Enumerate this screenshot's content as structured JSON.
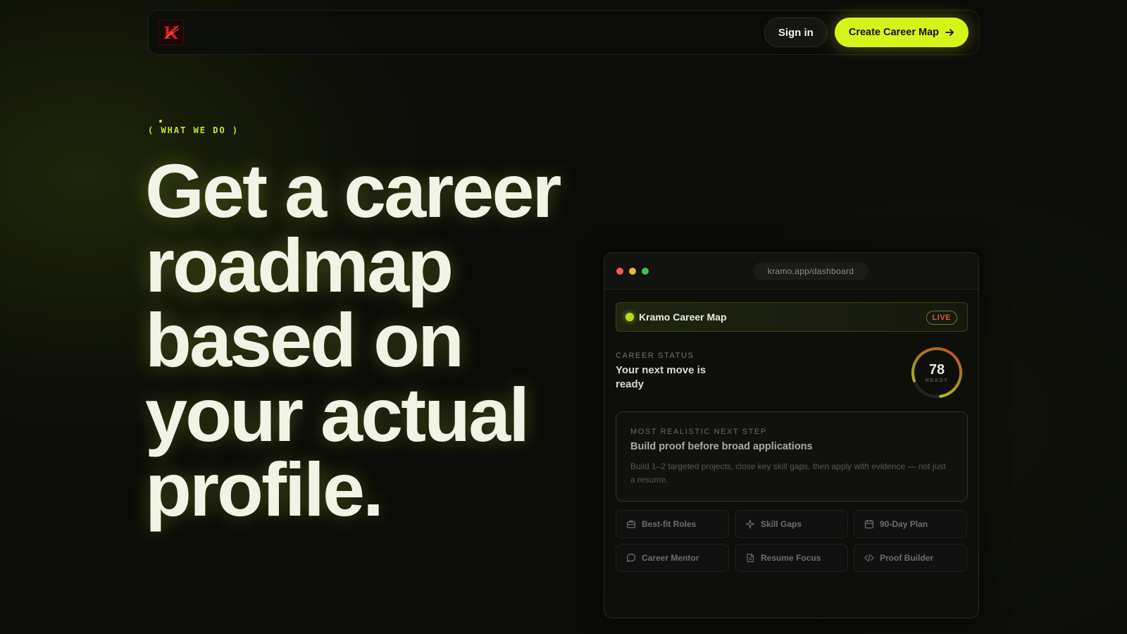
{
  "nav": {
    "logo_letter": "K",
    "signin_label": "Sign in",
    "cta_label": "Create Career Map"
  },
  "hero": {
    "eyebrow": "( WHAT WE DO )",
    "headline": "Get a career roadmap based on your actual profile."
  },
  "dashboard": {
    "url": "kramo.app/dashboard",
    "map_title": "Kramo Career Map",
    "live_badge": "LIVE",
    "status_label": "CAREER STATUS",
    "status_text": "Your next move is ready",
    "score": "78",
    "score_label": "READY",
    "score_fraction": 0.78,
    "step_label": "MOST REALISTIC NEXT STEP",
    "step_title": "Build proof before broad applications",
    "step_desc": "Build 1–2 targeted projects, close key skill gaps, then apply with evidence — not just a resume.",
    "tiles": [
      {
        "label": "Best-fit Roles",
        "icon": "briefcase-icon"
      },
      {
        "label": "Skill Gaps",
        "icon": "sparkle-icon"
      },
      {
        "label": "90-Day Plan",
        "icon": "calendar-icon"
      },
      {
        "label": "Career Mentor",
        "icon": "chat-icon"
      },
      {
        "label": "Resume Focus",
        "icon": "document-icon"
      },
      {
        "label": "Proof Builder",
        "icon": "code-icon"
      }
    ]
  },
  "colors": {
    "accent": "#d6f41a",
    "background": "#0b0c09",
    "live_text": "#e05a2c"
  }
}
